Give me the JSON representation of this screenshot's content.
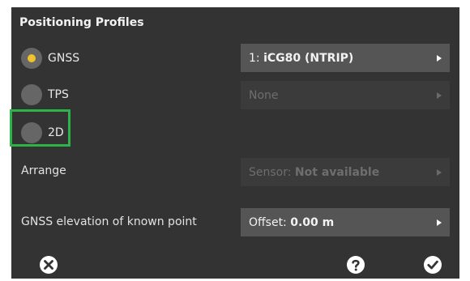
{
  "dialog": {
    "title": "Positioning Profiles"
  },
  "profiles": [
    {
      "label": "GNSS",
      "selected": true
    },
    {
      "label": "TPS",
      "selected": false
    },
    {
      "label": "2D",
      "selected": false
    }
  ],
  "gnss_select": {
    "prefix": "1: ",
    "value": "iCG80 (NTRIP)"
  },
  "tps_select": {
    "value": "None"
  },
  "arrange": {
    "label": "Arrange",
    "select_prefix": "Sensor: ",
    "select_value": "Not available"
  },
  "elevation": {
    "label": "GNSS elevation of known point",
    "select_prefix": "Offset: ",
    "select_value": "0.00 m"
  },
  "colors": {
    "panel_bg": "#333333",
    "radio_selected_dot": "#f2c12e",
    "highlight_border": "#2db34a"
  },
  "icons": {
    "cancel": "close-circle-icon",
    "help": "help-icon",
    "confirm": "check-circle-icon",
    "dropdown": "triangle-right-icon"
  }
}
